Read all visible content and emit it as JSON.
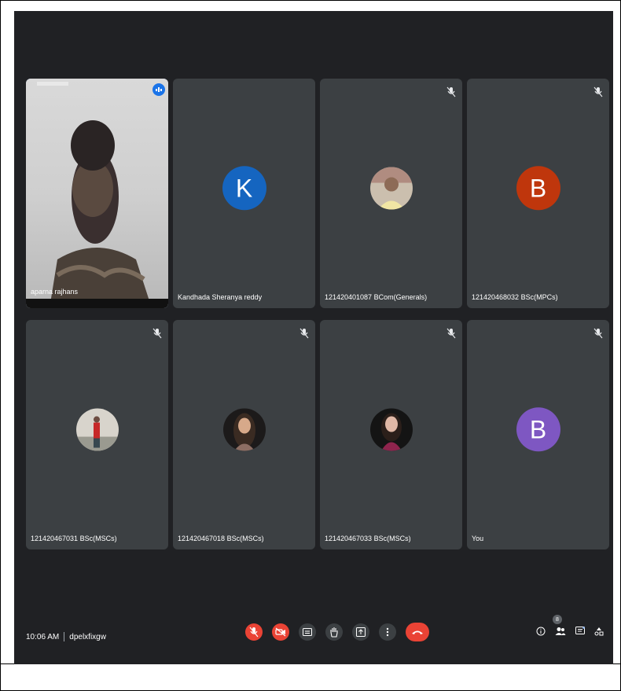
{
  "meeting": {
    "time": "10:06 AM",
    "code": "dpelxfixgw"
  },
  "participants": [
    {
      "name": "aparna rajhans",
      "type": "video",
      "speaking": true,
      "muted": false
    },
    {
      "name": "Kandhada Sheranya reddy",
      "type": "initial",
      "initial": "K",
      "color": "#1565c0",
      "muted": false
    },
    {
      "name": "121420401087 BCom(Generals)",
      "type": "photo",
      "muted": true
    },
    {
      "name": "121420468032 BSc(MPCs)",
      "type": "initial",
      "initial": "B",
      "color": "#bf360c",
      "muted": true
    },
    {
      "name": "121420467031 BSc(MSCs)",
      "type": "photo",
      "muted": true
    },
    {
      "name": "121420467018 BSc(MSCs)",
      "type": "photo",
      "muted": true
    },
    {
      "name": "121420467033 BSc(MSCs)",
      "type": "photo",
      "muted": true
    },
    {
      "name": "You",
      "type": "initial",
      "initial": "B",
      "color": "#7e57c2",
      "muted": true
    }
  ],
  "controls": {
    "icons": [
      "mic-off-icon",
      "camera-off-icon",
      "captions-icon",
      "raise-hand-icon",
      "present-icon",
      "more-icon",
      "end-call-icon"
    ]
  },
  "side_tools": {
    "icons": [
      "info-icon",
      "people-icon",
      "chat-icon",
      "activities-icon"
    ],
    "people_count": "8"
  }
}
